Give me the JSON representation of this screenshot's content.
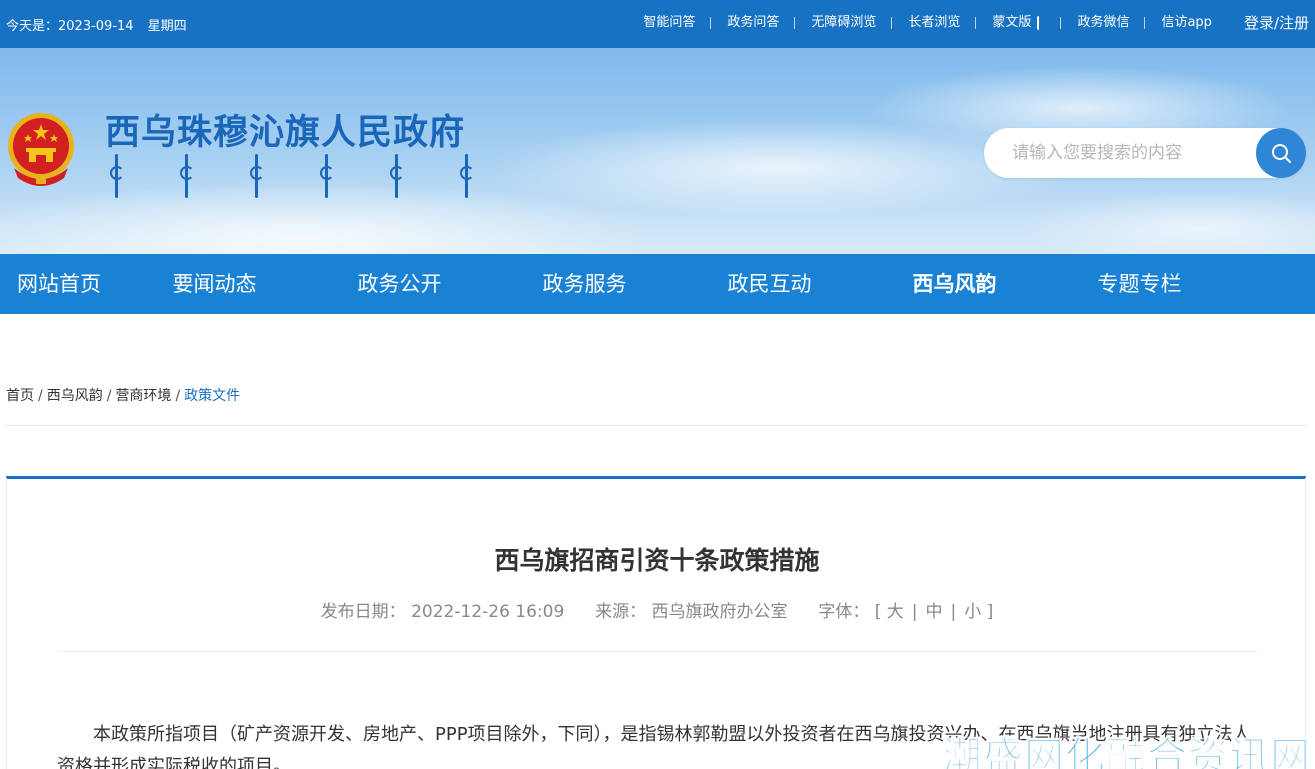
{
  "topbar": {
    "date_label": "今天是：2023-09-14",
    "weekday": "星期四",
    "links": [
      "智能问答",
      "政务问答",
      "无障碍浏览",
      "长者浏览",
      "蒙文版",
      "政务微信",
      "信访app"
    ],
    "login": "登录/注册"
  },
  "header": {
    "site_title": "西乌珠穆沁旗人民政府",
    "search_placeholder": "请输入您要搜索的内容",
    "search_icon": "search-icon",
    "emblem_icon": "national-emblem-icon"
  },
  "nav": {
    "items": [
      "网站首页",
      "要闻动态",
      "政务公开",
      "政务服务",
      "政民互动",
      "西乌风韵",
      "专题专栏"
    ],
    "active": "西乌风韵"
  },
  "breadcrumb": {
    "items": [
      "首页",
      "西乌风韵",
      "营商环境",
      "政策文件"
    ],
    "separator": "/"
  },
  "article": {
    "title": "西乌旗招商引资十条政策措施",
    "publish_label": "发布日期：",
    "publish_date": "2022-12-26 16:09",
    "source_label": "来源：",
    "source": "西乌旗政府办公室",
    "font_label": "字体：",
    "bracket_open": "[",
    "bracket_close": "]",
    "font_sizes": [
      "大",
      "中",
      "小"
    ],
    "body": "本政策所指项目（矿产资源开发、房地产、PPP项目除外，下同），是指锡林郭勒盟以外投资者在西乌旗投资兴办、在西乌旗当地注册具有独立法人资格并形成实际税收的项目。"
  },
  "watermark": "潮盛网化融合资讯网",
  "colors": {
    "topbar": "#1872c4",
    "nav": "#1a82d4",
    "title_blue": "#1a66b8",
    "accent": "#1a6fc0"
  }
}
